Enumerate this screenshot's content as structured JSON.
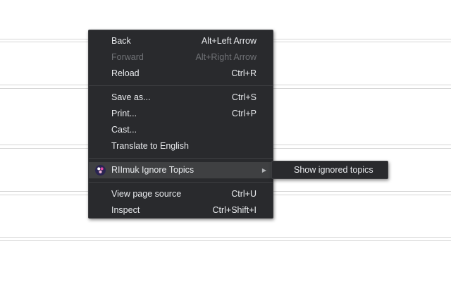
{
  "context_menu": {
    "items": [
      {
        "label": "Back",
        "shortcut": "Alt+Left Arrow"
      },
      {
        "label": "Forward",
        "shortcut": "Alt+Right Arrow"
      },
      {
        "label": "Reload",
        "shortcut": "Ctrl+R"
      },
      {
        "label": "Save as...",
        "shortcut": "Ctrl+S"
      },
      {
        "label": "Print...",
        "shortcut": "Ctrl+P"
      },
      {
        "label": "Cast...",
        "shortcut": ""
      },
      {
        "label": "Translate to English",
        "shortcut": ""
      },
      {
        "label": "RIImuk Ignore Topics",
        "shortcut": ""
      },
      {
        "label": "View page source",
        "shortcut": "Ctrl+U"
      },
      {
        "label": "Inspect",
        "shortcut": "Ctrl+Shift+I"
      }
    ]
  },
  "submenu": {
    "items": [
      {
        "label": "Show ignored topics"
      }
    ]
  },
  "icons": {
    "extension": "extension-icon",
    "submenu_arrow": "chevron-right-icon"
  },
  "colors": {
    "menu_background": "#292a2d",
    "menu_text": "#e8eaed",
    "disabled_text": "#6f7175",
    "highlight": "#3f4042"
  }
}
